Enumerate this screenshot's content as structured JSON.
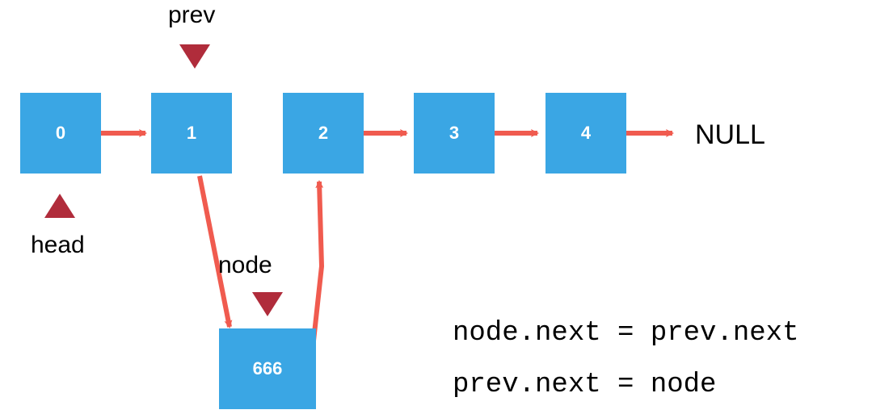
{
  "diagram": {
    "nodes": [
      "0",
      "1",
      "2",
      "3",
      "4"
    ],
    "insert_value": "666",
    "null_label": "NULL",
    "labels": {
      "prev": "prev",
      "head": "head",
      "node": "node"
    },
    "code": {
      "line1": "node.next = prev.next",
      "line2": "prev.next = node"
    },
    "colors": {
      "node_fill": "#3AA6E4",
      "pointer_triangle": "#B02C3B",
      "arrow": "#F05B4F"
    }
  }
}
